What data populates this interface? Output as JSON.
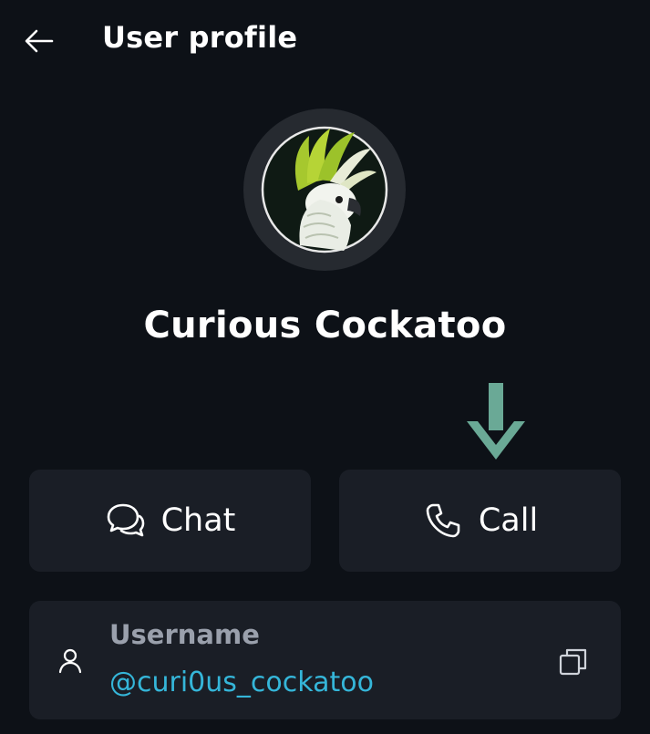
{
  "header": {
    "title": "User profile",
    "back_icon": "arrow-left-icon"
  },
  "profile": {
    "display_name": "Curious Cockatoo",
    "avatar": "cockatoo-avatar"
  },
  "actions": [
    {
      "label": "Chat",
      "icon": "chat-bubbles-icon"
    },
    {
      "label": "Call",
      "icon": "phone-icon"
    }
  ],
  "username_card": {
    "label": "Username",
    "value": "@curi0us_cockatoo",
    "left_icon": "user-icon",
    "right_icon": "copy-icon"
  },
  "colors": {
    "background": "#0d1117",
    "card": "#1a1e26",
    "accent_link": "#35b6d9",
    "indicator_arrow": "#6aa996",
    "muted_label": "#9aa0ac"
  }
}
